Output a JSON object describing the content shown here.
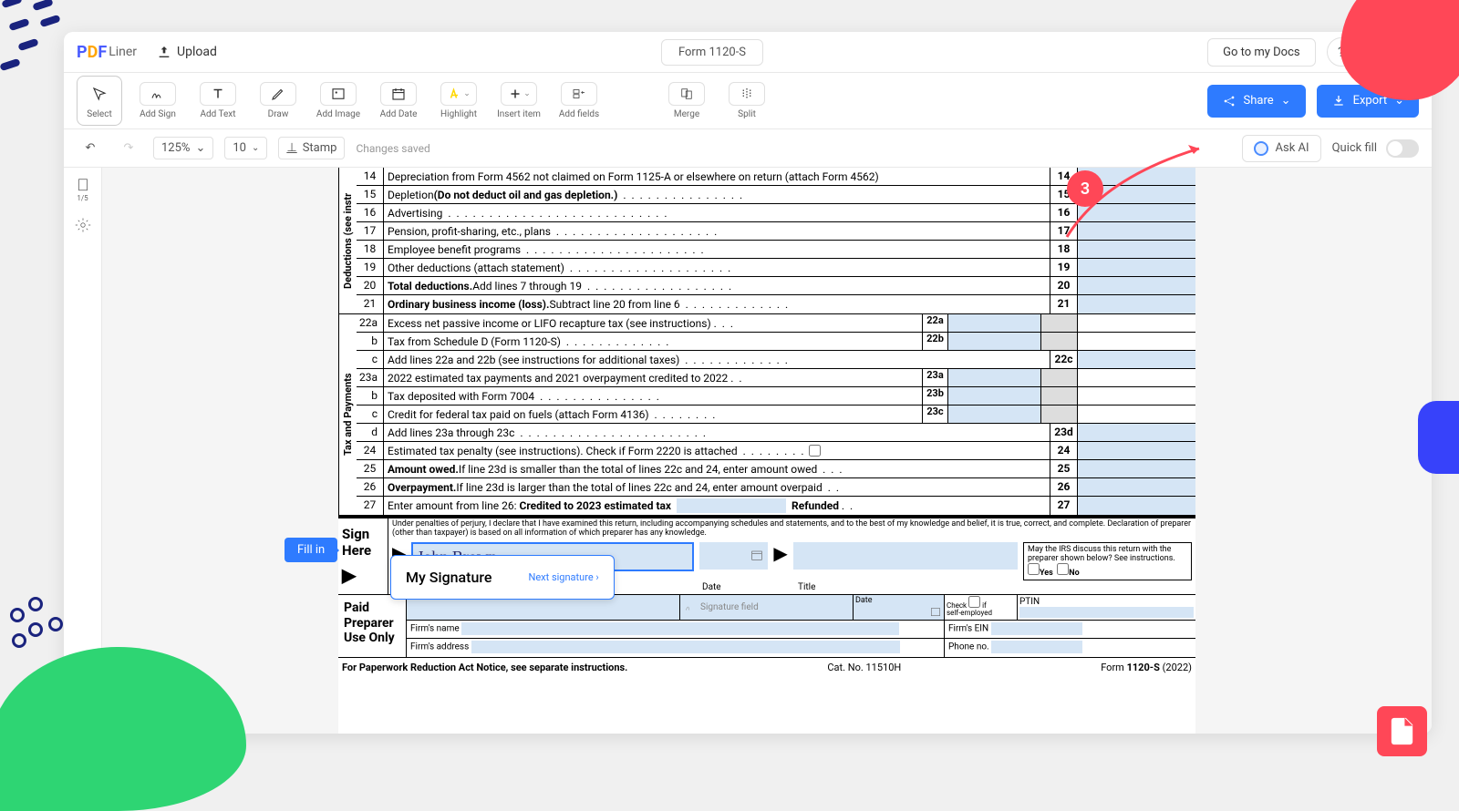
{
  "logo": {
    "p": "P",
    "d": "D",
    "f": "F",
    "liner": "Liner"
  },
  "header": {
    "upload": "Upload",
    "docTitle": "Form 1120-S",
    "goToDocs": "Go to my Docs",
    "help": "?"
  },
  "tools": {
    "select": "Select",
    "addSign": "Add Sign",
    "addText": "Add Text",
    "draw": "Draw",
    "addImage": "Add Image",
    "addDate": "Add Date",
    "highlight": "Highlight",
    "insertItem": "Insert item",
    "addFields": "Add fields",
    "merge": "Merge",
    "split": "Split",
    "share": "Share",
    "export": "Export"
  },
  "toolbar2": {
    "zoom": "125%",
    "pages": "10",
    "stamp": "Stamp",
    "saved": "Changes saved",
    "askAI": "Ask AI",
    "quickfill": "Quick fill"
  },
  "sidebar": {
    "pages": "1/5"
  },
  "fillin": "Fill in",
  "badge": "3",
  "form": {
    "r14": {
      "n": "14",
      "t": "Depreciation from Form 4562 not claimed on Form 1125-A or elsewhere on return (attach Form 4562)",
      "rn": "14"
    },
    "r15": {
      "n": "15",
      "t1": "Depletion ",
      "t2": "(Do not deduct oil and gas depletion.)",
      "rn": "15"
    },
    "r16": {
      "n": "16",
      "t": "Advertising",
      "rn": "16"
    },
    "r17": {
      "n": "17",
      "t": "Pension, profit-sharing, etc., plans",
      "rn": "17"
    },
    "r18": {
      "n": "18",
      "t": "Employee benefit programs",
      "rn": "18"
    },
    "r19": {
      "n": "19",
      "t": "Other deductions (attach statement)",
      "rn": "19"
    },
    "r20": {
      "n": "20",
      "t1": "Total deductions.",
      "t2": " Add lines 7 through 19",
      "rn": "20"
    },
    "r21": {
      "n": "21",
      "t1": "Ordinary business income (loss).",
      "t2": " Subtract line 20 from line 6",
      "rn": "21"
    },
    "r22a": {
      "n": "22a",
      "t": "Excess net passive income or LIFO recapture tax (see instructions)",
      "sn": "22a"
    },
    "r22b": {
      "n": "b",
      "t": "Tax from Schedule D (Form 1120-S)",
      "sn": "22b"
    },
    "r22c": {
      "n": "c",
      "t": "Add lines 22a and 22b (see instructions for additional taxes)",
      "rn": "22c"
    },
    "r23a": {
      "n": "23a",
      "t": "2022 estimated tax payments and 2021 overpayment credited to 2022",
      "sn": "23a"
    },
    "r23b": {
      "n": "b",
      "t": "Tax deposited with Form 7004",
      "sn": "23b"
    },
    "r23c": {
      "n": "c",
      "t": "Credit for federal tax paid on fuels (attach Form 4136)",
      "sn": "23c"
    },
    "r23d": {
      "n": "d",
      "t": "Add lines 23a through 23c",
      "rn": "23d"
    },
    "r24": {
      "n": "24",
      "t": "Estimated tax penalty (see instructions). Check if Form 2220 is attached",
      "rn": "24"
    },
    "r25": {
      "n": "25",
      "t1": "Amount owed.",
      "t2": " If line 23d is smaller than the total of lines 22c and 24, enter amount owed",
      "rn": "25"
    },
    "r26": {
      "n": "26",
      "t1": "Overpayment.",
      "t2": " If line 23d is larger than the total of lines 22c and 24, enter amount overpaid",
      "rn": "26"
    },
    "r27": {
      "n": "27",
      "t1": "Enter amount from line 26: ",
      "t2": "Credited to 2023 estimated tax",
      "t3": "Refunded",
      "rn": "27"
    },
    "sectDed": "Deductions (see instr",
    "sectTax": "Tax and Payments",
    "signHere": "Sign Here",
    "perjury": "Under penalties of perjury, I declare that I have examined this return, including accompanying schedules and statements, and to the best of my knowledge and belief, it is true, correct, and complete. Declaration of preparer (other than taxpayer) is based on all information of which preparer has any knowledge.",
    "sigValue": "John Brown",
    "date": "Date",
    "title": "Title",
    "irsQ": "May the IRS discuss this return with the preparer shown below? See instructions.",
    "yes": "Yes",
    "no": "No",
    "paidPrep": "Paid Preparer Use Only",
    "sigFieldPh": "Signature field",
    "dateLbl": "Date",
    "checkSelf1": "Check",
    "checkSelf2": "if",
    "checkSelf3": "self-employed",
    "ptin": "PTIN",
    "firmName": "Firm's name",
    "firmEIN": "Firm's EIN",
    "firmAddr": "Firm's address",
    "phone": "Phone no.",
    "footerL": "For Paperwork Reduction Act Notice, see separate instructions.",
    "footerC": "Cat. No. 11510H",
    "footerR1": "Form ",
    "footerR2": "1120-S",
    "footerR3": " (2022)"
  },
  "popup": {
    "title": "My Signature",
    "next": "Next signature"
  }
}
